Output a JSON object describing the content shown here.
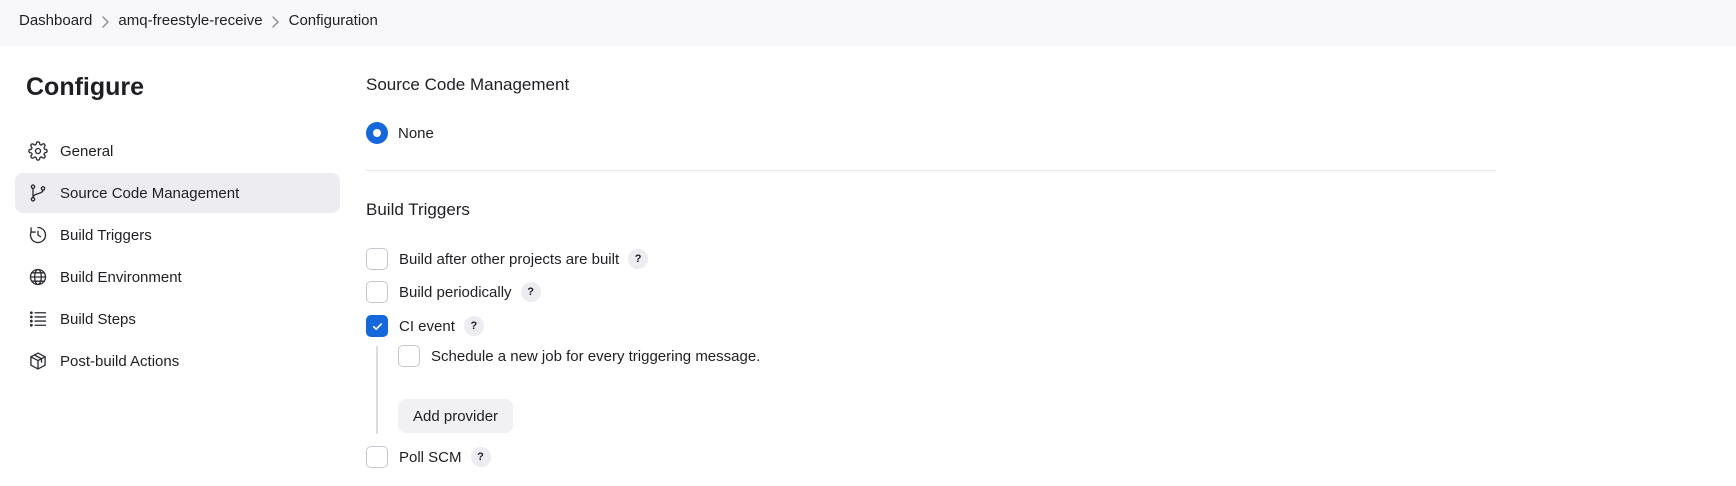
{
  "breadcrumb": {
    "items": [
      "Dashboard",
      "amq-freestyle-receive",
      "Configuration"
    ]
  },
  "sidebar": {
    "title": "Configure",
    "items": [
      {
        "label": "General",
        "icon": "gear-icon"
      },
      {
        "label": "Source Code Management",
        "icon": "branch-icon",
        "active": true
      },
      {
        "label": "Build Triggers",
        "icon": "clock-icon"
      },
      {
        "label": "Build Environment",
        "icon": "globe-icon"
      },
      {
        "label": "Build Steps",
        "icon": "list-icon"
      },
      {
        "label": "Post-build Actions",
        "icon": "package-icon"
      }
    ]
  },
  "scm": {
    "title": "Source Code Management",
    "options": [
      {
        "label": "None",
        "selected": true
      }
    ]
  },
  "triggers": {
    "title": "Build Triggers",
    "help_symbol": "?",
    "items": [
      {
        "label": "Build after other projects are built",
        "checked": false
      },
      {
        "label": "Build periodically",
        "checked": false
      },
      {
        "label": "CI event",
        "checked": true
      },
      {
        "label": "Poll SCM",
        "checked": false
      }
    ],
    "ci_event": {
      "sub_option_label": "Schedule a new job for every triggering message.",
      "sub_option_checked": false,
      "add_provider_label": "Add provider"
    }
  },
  "colors": {
    "accent": "#1468dc",
    "active_nav_bg": "#ededf1",
    "topbar_bg": "#f8f8fa"
  }
}
